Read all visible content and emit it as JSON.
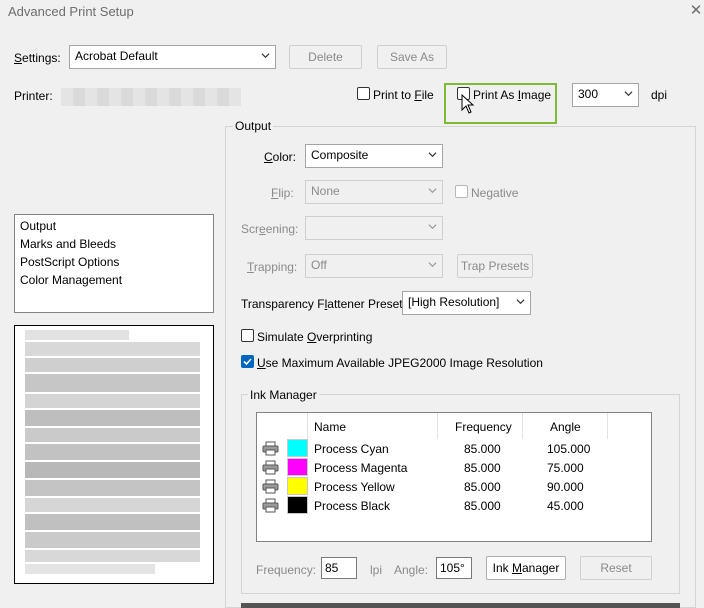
{
  "window": {
    "title": "Advanced Print Setup"
  },
  "settings": {
    "label": "Settings:",
    "value": "Acrobat Default",
    "delete_label": "Delete",
    "save_as_label": "Save As"
  },
  "printer": {
    "label": "Printer:",
    "print_to_file": "Print to File",
    "print_to_file_checked": false,
    "print_as_image": "Print As Image",
    "print_as_image_checked": false,
    "dpi_value": "300",
    "dpi_unit": "dpi"
  },
  "categories": {
    "items": [
      "Output",
      "Marks and Bleeds",
      "PostScript Options",
      "Color Management"
    ],
    "selected": "Output"
  },
  "output": {
    "group_label": "Output",
    "color": {
      "label": "Color:",
      "value": "Composite"
    },
    "flip": {
      "label": "Flip:",
      "value": "None",
      "negative_label": "Negative",
      "negative_checked": false
    },
    "screening": {
      "label": "Screening:",
      "value": ""
    },
    "trapping": {
      "label": "Trapping:",
      "value": "Off",
      "trap_presets_label": "Trap Presets"
    },
    "flattener": {
      "label": "Transparency Flattener Preset:",
      "value": "[High Resolution]"
    },
    "simulate_overprinting": {
      "label": "Simulate Overprinting",
      "checked": false
    },
    "jpeg2000": {
      "label": "Use Maximum Available JPEG2000 Image Resolution",
      "checked": true
    }
  },
  "ink_manager": {
    "group_label": "Ink Manager",
    "columns": [
      "Name",
      "Frequency",
      "Angle"
    ],
    "rows": [
      {
        "name": "Process Cyan",
        "frequency": "85.000",
        "angle": "105.000",
        "color": "#00ffff"
      },
      {
        "name": "Process Magenta",
        "frequency": "85.000",
        "angle": "75.000",
        "color": "#ff00ff"
      },
      {
        "name": "Process Yellow",
        "frequency": "85.000",
        "angle": "90.000",
        "color": "#ffff00"
      },
      {
        "name": "Process Black",
        "frequency": "85.000",
        "angle": "45.000",
        "color": "#000000"
      }
    ],
    "frequency_label": "Frequency:",
    "frequency_value": "85",
    "lpi_label": "lpi",
    "angle_label": "Angle:",
    "angle_value": "105°",
    "ink_manager_button": "Ink Manager",
    "reset_button": "Reset"
  },
  "colors": {
    "accent_check": "#0067c0",
    "highlight_box": "#7cbb33"
  }
}
